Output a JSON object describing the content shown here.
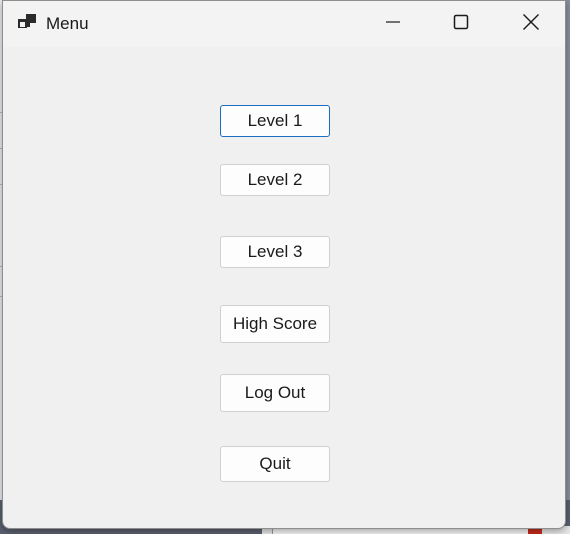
{
  "window": {
    "title": "Menu",
    "icon": "app-window-icon",
    "controls": {
      "minimize_icon": "minimize-icon",
      "maximize_icon": "maximize-icon",
      "close_icon": "close-icon"
    }
  },
  "menu": {
    "buttons": [
      {
        "label": "Level 1",
        "focused": true
      },
      {
        "label": "Level 2",
        "focused": false
      },
      {
        "label": "Level 3",
        "focused": false
      },
      {
        "label": "High Score",
        "focused": false
      },
      {
        "label": "Log Out",
        "focused": false
      },
      {
        "label": "Quit",
        "focused": false
      }
    ]
  },
  "colors": {
    "window_bg": "#f0f0f0",
    "button_bg": "#fdfdfd",
    "focus_border": "#1a6fc4"
  }
}
